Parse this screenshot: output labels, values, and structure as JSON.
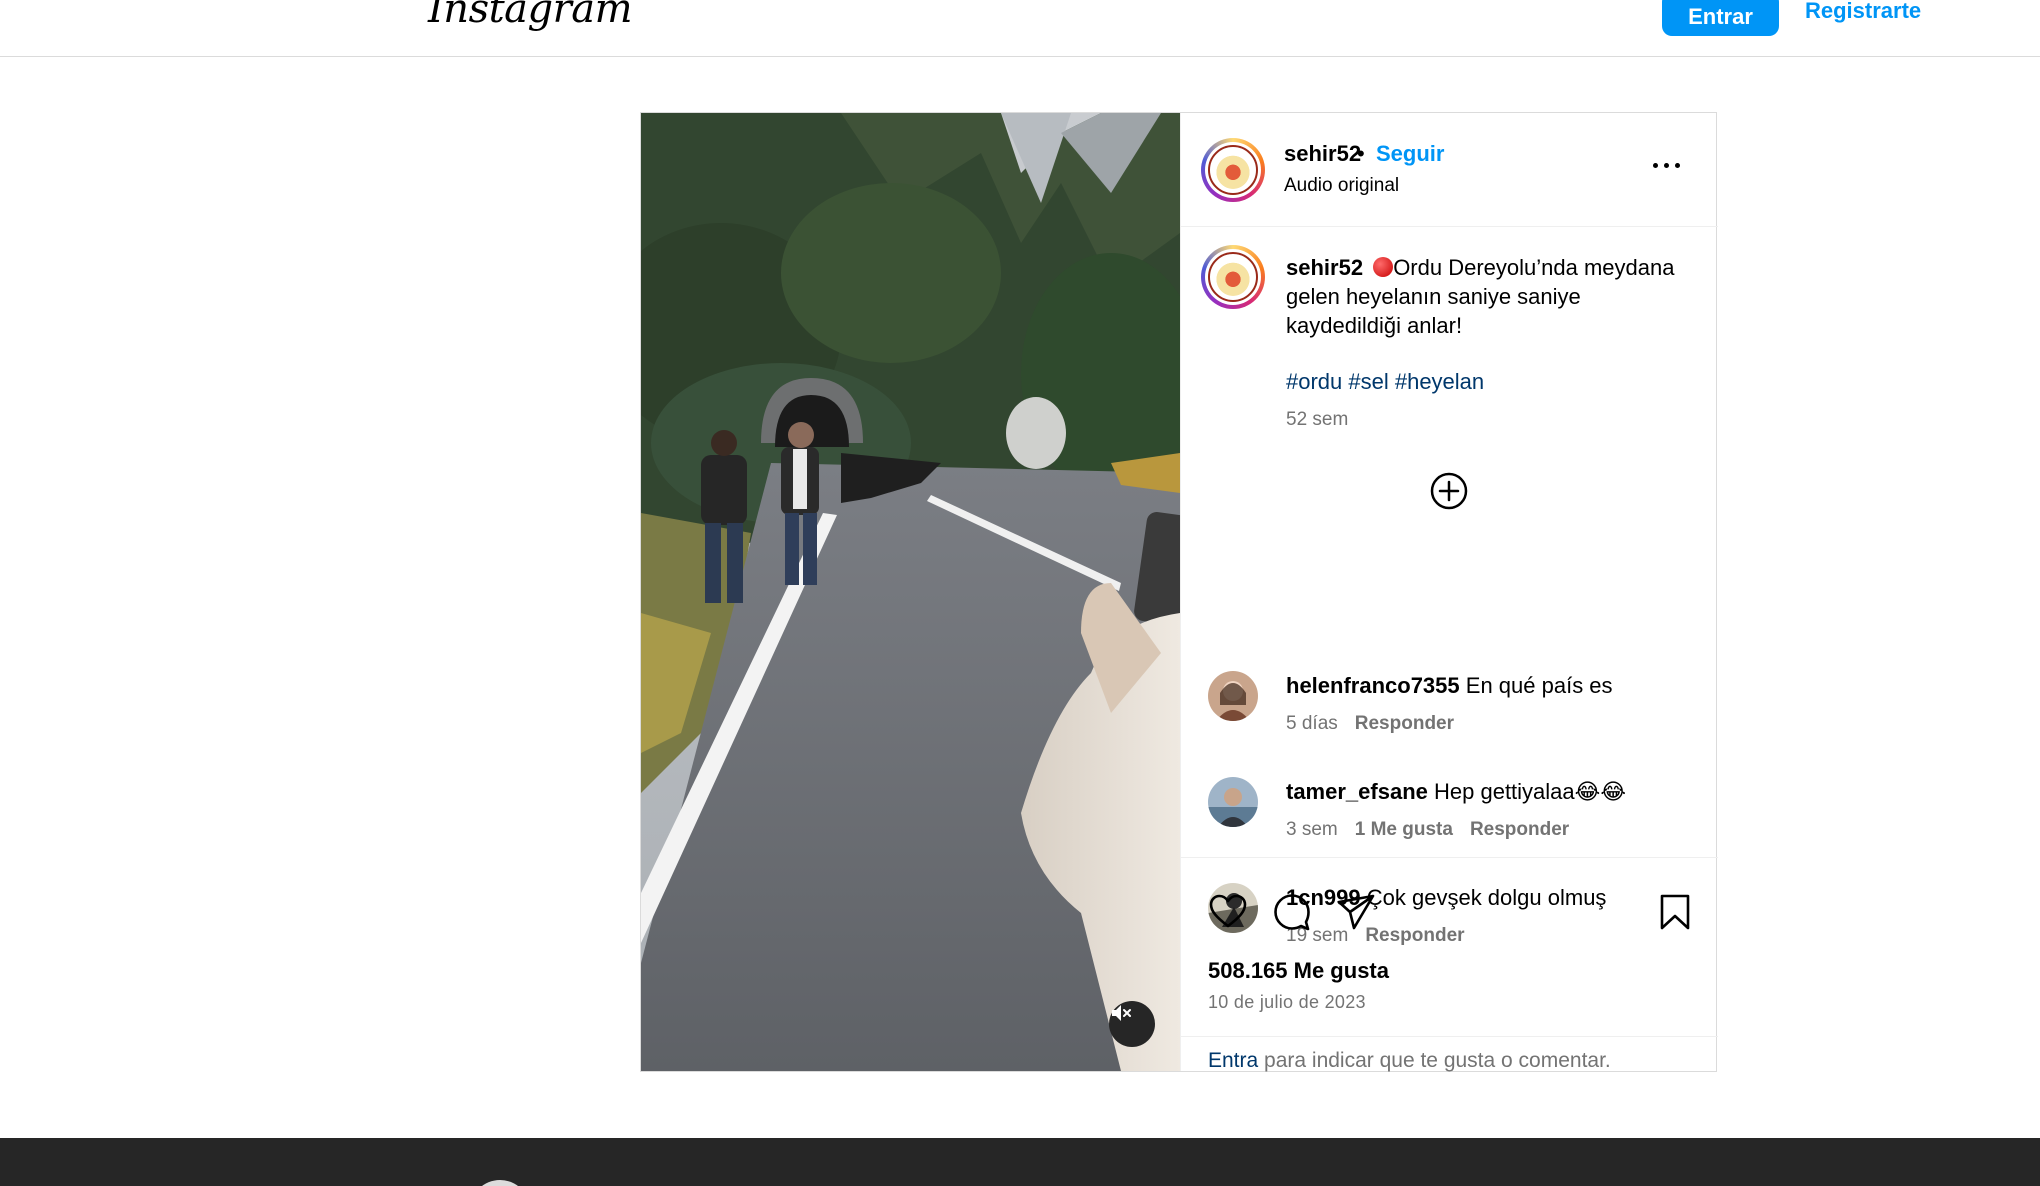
{
  "topbar": {
    "logo": "Instagram",
    "login_label": "Entrar",
    "signup_label": "Registrarte"
  },
  "post": {
    "username": "sehir52",
    "separator": "•",
    "follow_label": "Seguir",
    "audio_label": "Audio original",
    "caption": {
      "username": "sehir52",
      "text": "Ordu Dereyolu’nda meydana gelen heyelanın saniye saniye kaydedildiği anlar!",
      "hashtags": "#ordu #sel #heyelan",
      "time": "52 sem"
    },
    "comments": [
      {
        "username": "helenfranco7355",
        "text": "En qué país es",
        "time": "5 días",
        "likes": "",
        "reply": "Responder"
      },
      {
        "username": "tamer_efsane",
        "text": "Hep gettiyalaa😂😂",
        "time": "3 sem",
        "likes": "1 Me gusta",
        "reply": "Responder"
      },
      {
        "username": "1cn999",
        "text": "Çok gevşek dolgu olmuş",
        "time": "19 sem",
        "likes": "",
        "reply": "Responder"
      }
    ],
    "likes_count": "508.165 Me gusta",
    "date": "10 de julio de 2023",
    "login_prompt_link": "Entra",
    "login_prompt_rest": " para indicar que te gusta o comentar."
  },
  "icons": {
    "mute": "volume-mute-icon",
    "more": "more-options-icon",
    "add": "add-circle-icon",
    "like": "heart-icon",
    "comment": "comment-icon",
    "share": "send-icon",
    "save": "bookmark-icon"
  },
  "colors": {
    "accent": "#0095f6",
    "link": "#00376b",
    "secondary_text": "#737373",
    "footer": "#262626"
  }
}
